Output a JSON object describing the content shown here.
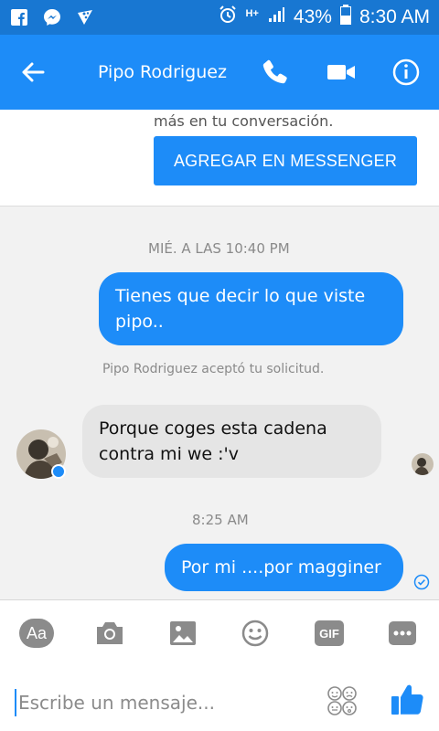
{
  "status_bar": {
    "battery": "43%",
    "time": "8:30 AM",
    "network": "H+"
  },
  "header": {
    "contact_name": "Pipo Rodriguez"
  },
  "invite_card": {
    "text": "más en tu conversación.",
    "button_label": "AGREGAR EN MESSENGER"
  },
  "messages": [
    {
      "kind": "timestamp",
      "text": "MIÉ. A LAS 10:40 PM"
    },
    {
      "kind": "outgoing",
      "text": "Tienes que decir lo que viste pipo.."
    },
    {
      "kind": "system",
      "text": "Pipo Rodriguez aceptó tu solicitud."
    },
    {
      "kind": "incoming",
      "text": "Porque coges esta cadena contra mi we :'v"
    },
    {
      "kind": "timestamp",
      "text": "8:25 AM"
    },
    {
      "kind": "outgoing",
      "text": "Por mi ....por magginer"
    }
  ],
  "composer": {
    "aa_label": "Aa",
    "gif_label": "GIF",
    "placeholder": "Escribe un mensaje..."
  },
  "colors": {
    "status_bar": "#1877d2",
    "app_bar": "#1d8cf8",
    "outgoing_bubble": "#1d8cf8",
    "incoming_bubble": "#e5e5e5",
    "tool_icon": "#8b8b8b"
  },
  "icons": {
    "status_left": [
      "facebook-icon",
      "messenger-icon",
      "pizza-icon"
    ],
    "status_right": [
      "alarm-icon",
      "network-type-icon",
      "signal-icon",
      "battery-icon"
    ],
    "header": [
      "back-arrow-icon",
      "phone-icon",
      "video-camera-icon",
      "info-icon"
    ],
    "composer": [
      "aa-icon",
      "camera-icon",
      "image-icon",
      "emoji-icon",
      "gif-icon",
      "more-icon",
      "sticker-icon",
      "like-icon"
    ]
  }
}
